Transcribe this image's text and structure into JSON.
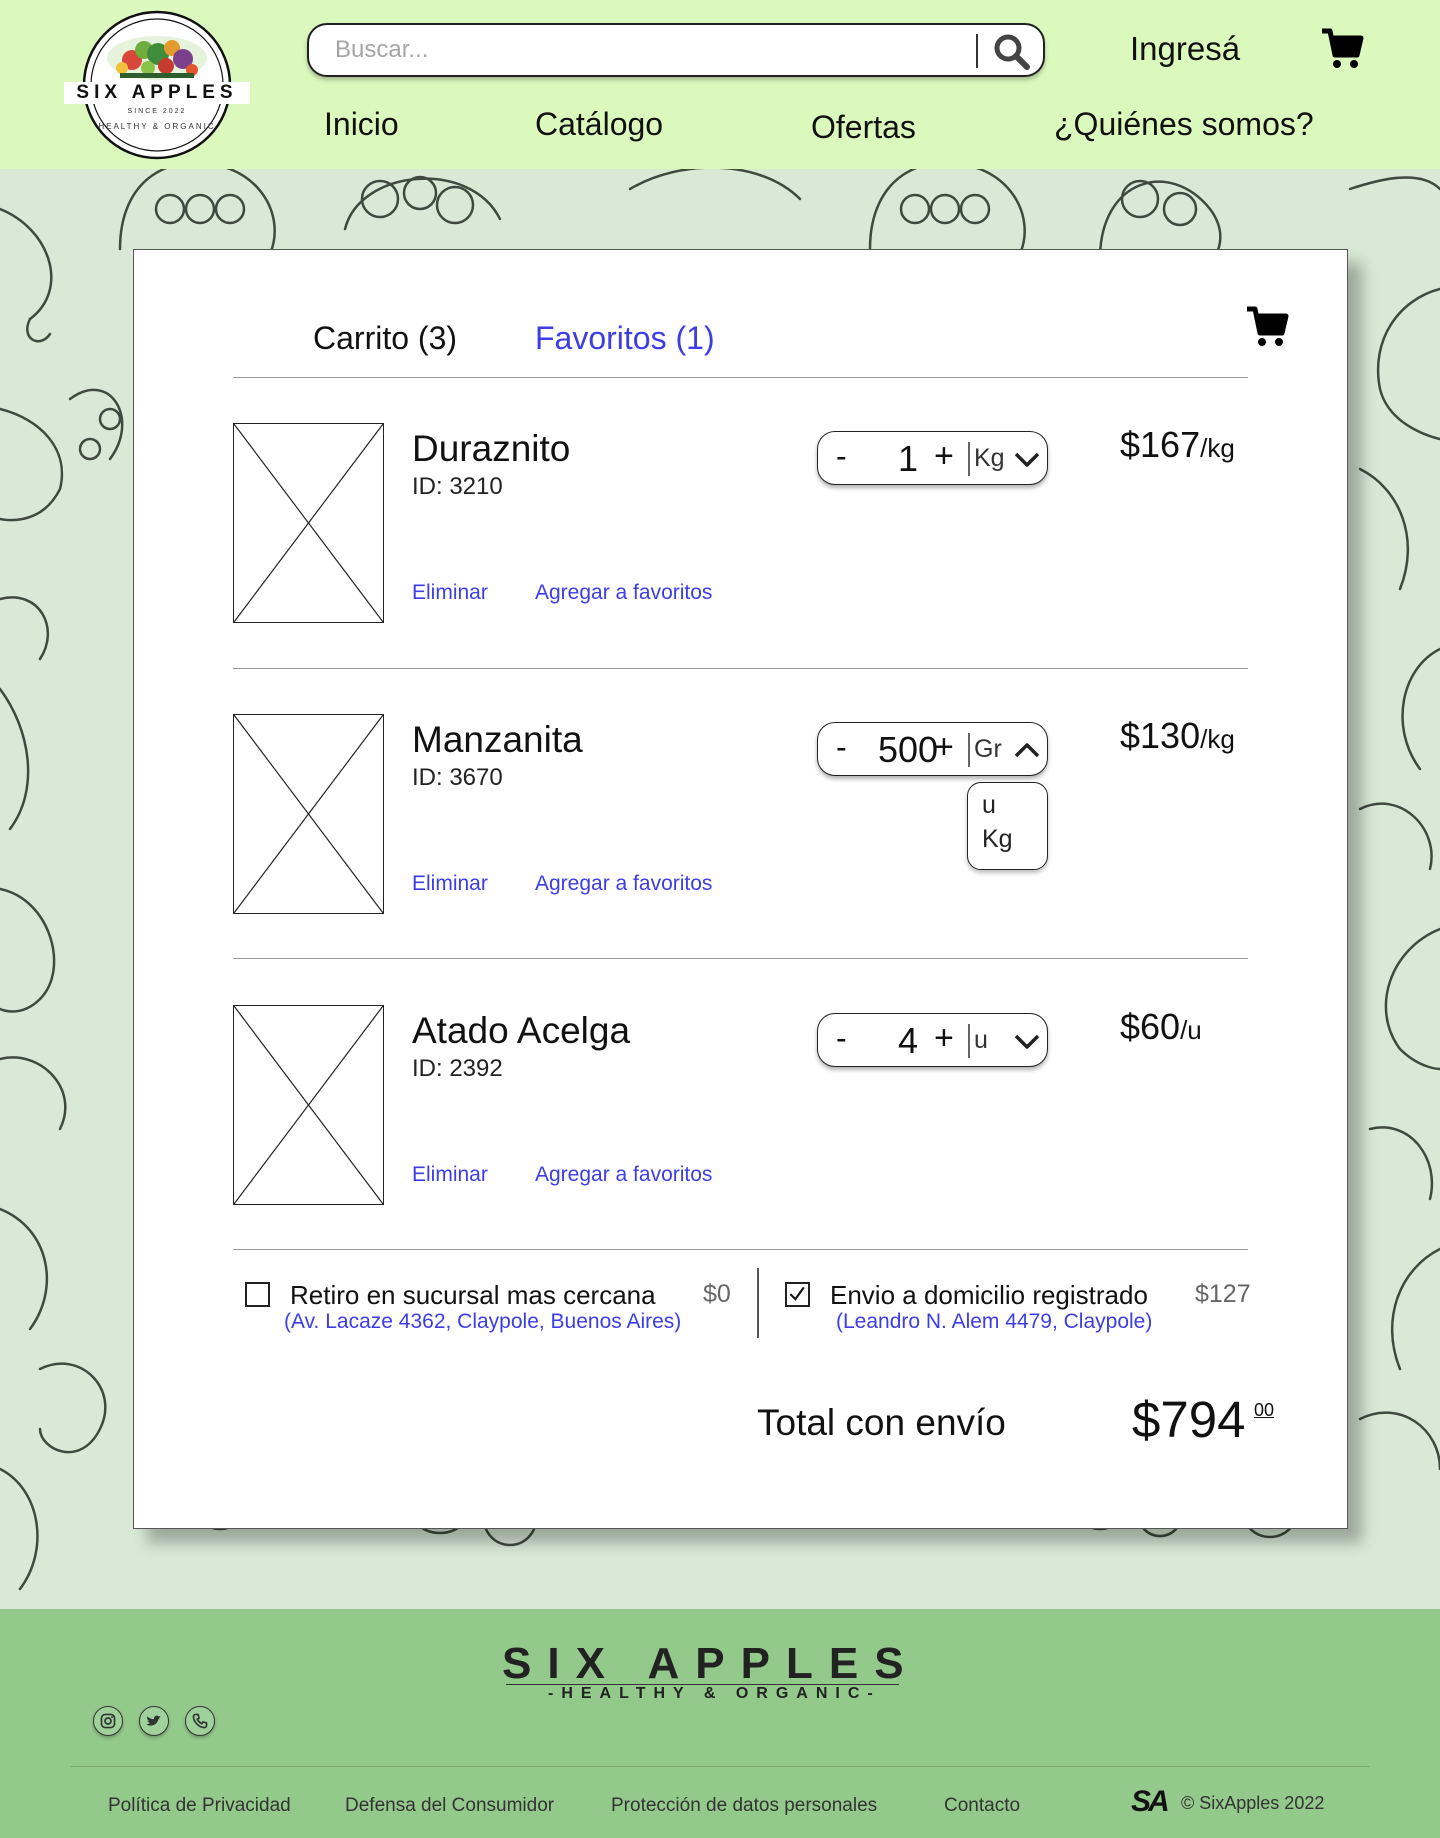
{
  "brand": {
    "logo_name": "SIX APPLES",
    "logo_since": "SINCE 2022",
    "logo_tagline": "HEALTHY & ORGANIC"
  },
  "header": {
    "search_placeholder": "Buscar...",
    "login_label": "Ingresá",
    "nav": [
      "Inicio",
      "Catálogo",
      "Ofertas",
      "¿Quiénes somos?"
    ]
  },
  "cart": {
    "tab_cart": "Carrito (3)",
    "tab_favorites": "Favoritos (1)",
    "items": [
      {
        "name": "Duraznito",
        "id": "ID: 3210",
        "qty": "1",
        "unit": "Kg",
        "price": "$167",
        "price_unit": "/kg",
        "remove_label": "Eliminar",
        "fav_label": "Agregar a favoritos"
      },
      {
        "name": "Manzanita",
        "id": "ID: 3670",
        "qty": "500",
        "unit": "Gr",
        "unit_options": [
          "u",
          "Kg"
        ],
        "price": "$130",
        "price_unit": "/kg",
        "remove_label": "Eliminar",
        "fav_label": "Agregar a favoritos"
      },
      {
        "name": "Atado Acelga",
        "id": "ID: 2392",
        "qty": "4",
        "unit": "u",
        "price": "$60",
        "price_unit": "/u",
        "remove_label": "Eliminar",
        "fav_label": "Agregar a favoritos"
      }
    ],
    "shipping": [
      {
        "label": "Retiro en sucursal mas cercana",
        "cost": "$0",
        "address": "(Av. Lacaze 4362, Claypole, Buenos Aires)",
        "checked": false
      },
      {
        "label": "Envio a domicilio registrado",
        "cost": "$127",
        "address": "(Leandro N. Alem 4479, Claypole)",
        "checked": true
      }
    ],
    "total_label": "Total con envío",
    "total_value": "$794",
    "total_cents": "00"
  },
  "footer": {
    "brand": "SIX APPLES",
    "tagline": "-HEALTHY & ORGANIC-",
    "social_icons": [
      "instagram-icon",
      "twitter-icon",
      "phone-icon"
    ],
    "links": [
      "Política de Privacidad",
      "Defensa del Consumidor",
      "Protección de datos personales",
      "Contacto"
    ],
    "mark": "SA",
    "copyright": "© SixApples 2022"
  },
  "colors": {
    "header_bg": "#dcf9bd",
    "page_bg": "#d8ead6",
    "footer_bg": "#93c98a",
    "link_blue": "#3d3de8"
  }
}
